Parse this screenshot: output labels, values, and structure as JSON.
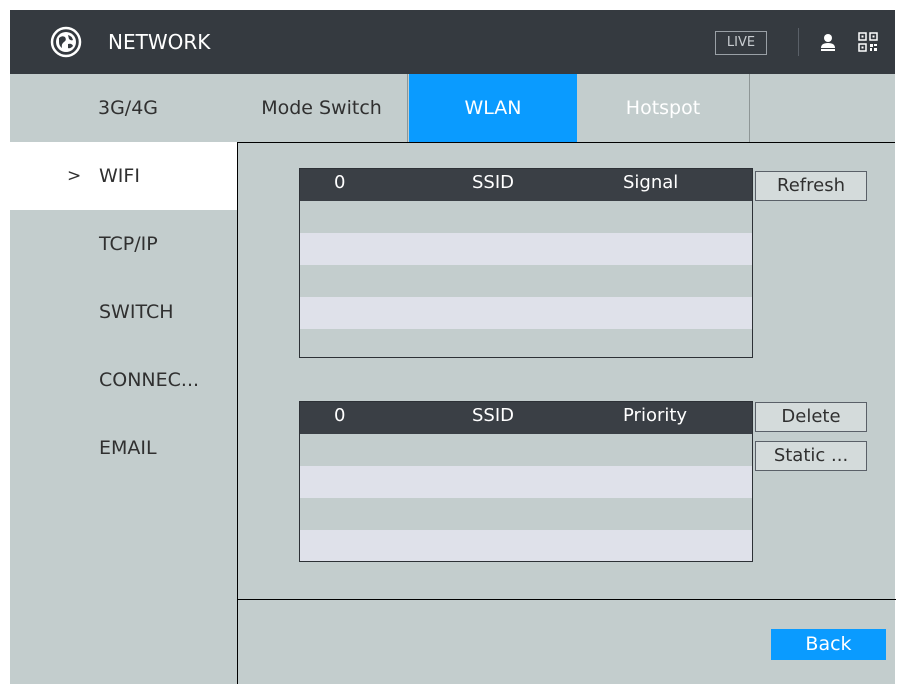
{
  "header": {
    "title": "NETWORK",
    "live_label": "LIVE",
    "icons": [
      "globe-icon",
      "user-icon",
      "qr-code-icon"
    ]
  },
  "tabs": [
    {
      "label": "3G/4G",
      "active": false
    },
    {
      "label": "Mode Switch",
      "active": false
    },
    {
      "label": "WLAN",
      "active": true
    },
    {
      "label": "Hotspot",
      "active": false
    }
  ],
  "sidebar": {
    "items": [
      {
        "label": "WIFI",
        "active": true,
        "chevron": ">"
      },
      {
        "label": "TCP/IP",
        "active": false
      },
      {
        "label": "SWITCH",
        "active": false
      },
      {
        "label": "CONNEC...",
        "active": false
      },
      {
        "label": "EMAIL",
        "active": false
      }
    ]
  },
  "wifi_table": {
    "columns": [
      "0",
      "SSID",
      "Signal"
    ],
    "rows": []
  },
  "saved_table": {
    "columns": [
      "0",
      "SSID",
      "Priority"
    ],
    "rows": []
  },
  "buttons": {
    "refresh": "Refresh",
    "delete": "Delete",
    "static": "Static ...",
    "back": "Back"
  },
  "colors": {
    "accent": "#0a9bff",
    "header_bg": "#353a40",
    "panel_bg": "#c3cdcd"
  }
}
